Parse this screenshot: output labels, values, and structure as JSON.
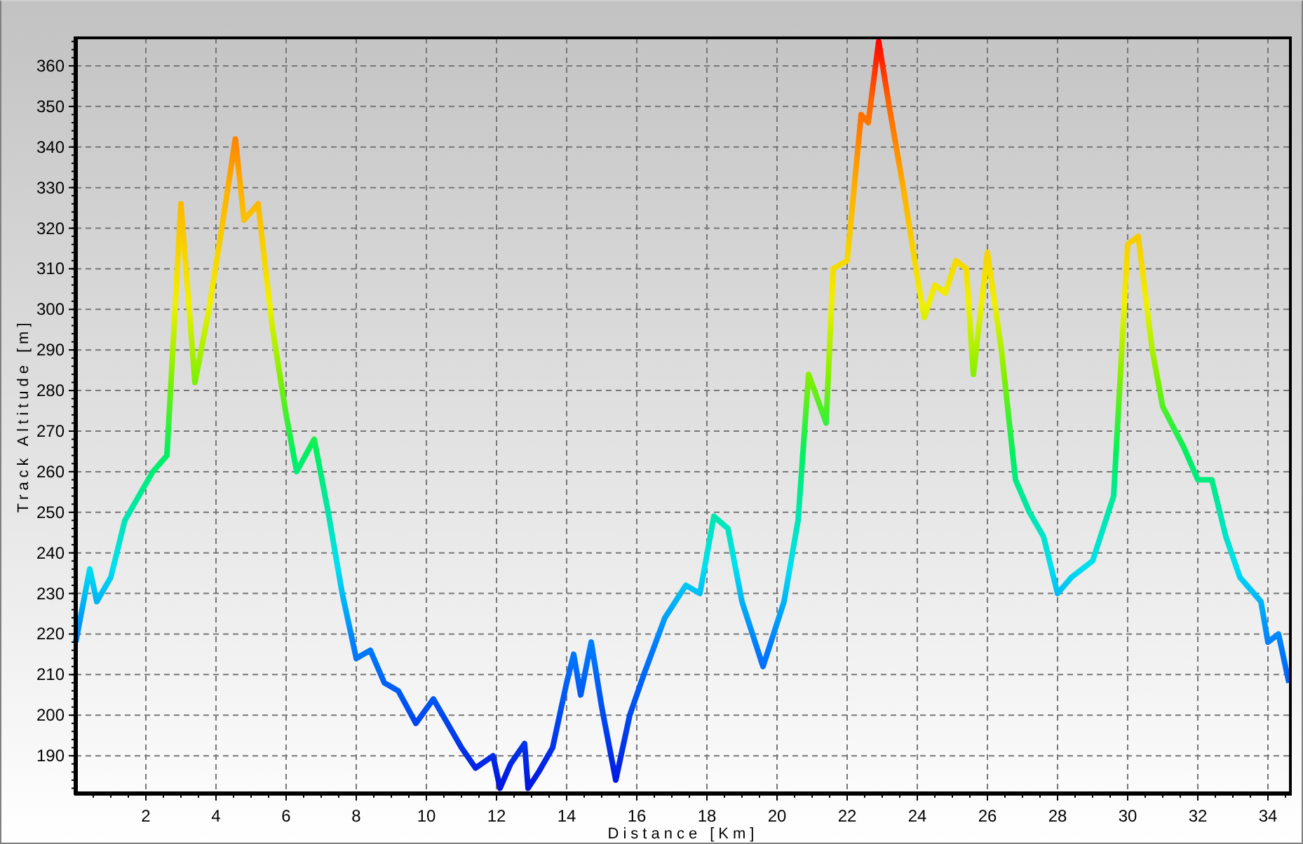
{
  "chart_data": {
    "type": "line",
    "xlabel": "Distance [Km]",
    "ylabel": "Track Altitude [m]",
    "x": [
      0,
      0.4,
      0.6,
      1,
      1.4,
      1.8,
      2.2,
      2.6,
      3.0,
      3.4,
      3.8,
      4.2,
      4.55,
      4.8,
      5.2,
      5.6,
      6.0,
      6.3,
      6.8,
      7.2,
      7.6,
      8.0,
      8.4,
      8.8,
      9.2,
      9.7,
      10.2,
      10.6,
      11.0,
      11.4,
      11.9,
      12.1,
      12.4,
      12.8,
      12.9,
      13.2,
      13.6,
      14.0,
      14.2,
      14.4,
      14.7,
      15.0,
      15.4,
      15.8,
      16.2,
      16.8,
      17.4,
      17.8,
      18.2,
      18.6,
      19.0,
      19.6,
      20.2,
      20.6,
      20.9,
      21.4,
      21.6,
      22.0,
      22.4,
      22.6,
      22.9,
      23.2,
      23.6,
      24.0,
      24.2,
      24.5,
      24.8,
      25.1,
      25.4,
      25.6,
      26.0,
      26.4,
      26.8,
      27.2,
      27.6,
      28.0,
      28.4,
      29.0,
      29.6,
      30.0,
      30.3,
      30.7,
      31.0,
      31.6,
      32.0,
      32.4,
      32.8,
      33.2,
      33.8,
      34.0,
      34.3,
      34.6
    ],
    "series": [
      {
        "values": [
          218,
          236,
          228,
          234,
          248,
          254,
          260,
          264,
          326,
          282,
          300,
          322,
          342,
          322,
          326,
          296,
          274,
          260,
          268,
          250,
          230,
          214,
          216,
          208,
          206,
          198,
          204,
          198,
          192,
          187,
          190,
          182,
          188,
          193,
          182,
          186,
          192,
          208,
          215,
          205,
          218,
          202,
          184,
          200,
          210,
          224,
          232,
          230,
          249,
          246,
          228,
          212,
          228,
          248,
          284,
          272,
          310,
          312,
          348,
          346,
          366,
          350,
          330,
          308,
          298,
          306,
          304,
          312,
          310,
          284,
          314,
          290,
          258,
          250,
          244,
          230,
          234,
          238,
          254,
          316,
          318,
          290,
          276,
          266,
          258,
          258,
          244,
          234,
          228,
          218,
          220,
          208
        ]
      }
    ],
    "grid": true,
    "xlim": [
      0,
      34.64
    ],
    "ylim": [
      180.7,
      366.9
    ],
    "xticks": [
      2,
      4,
      6,
      8,
      10,
      12,
      14,
      16,
      18,
      20,
      22,
      24,
      26,
      28,
      30,
      32,
      34
    ],
    "yticks": [
      190,
      200,
      210,
      220,
      230,
      240,
      250,
      260,
      270,
      280,
      290,
      300,
      310,
      320,
      330,
      340,
      350,
      360
    ]
  }
}
